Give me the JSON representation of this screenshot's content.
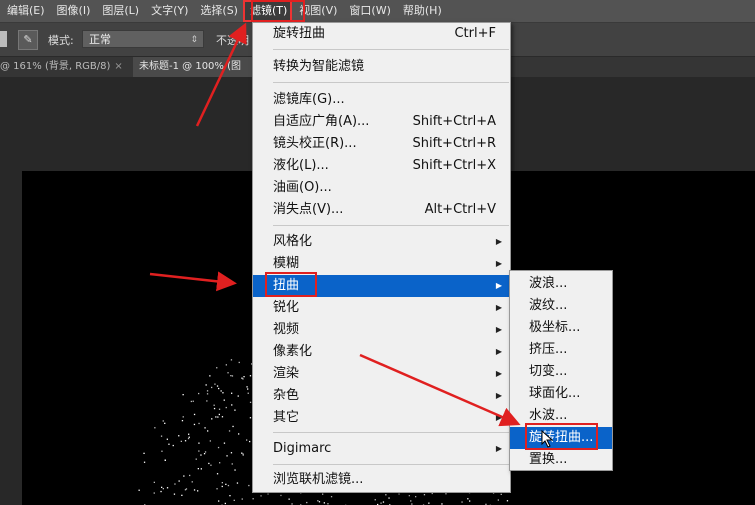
{
  "menubar": {
    "items": [
      {
        "label": "编辑(E)"
      },
      {
        "label": "图像(I)"
      },
      {
        "label": "图层(L)"
      },
      {
        "label": "文字(Y)"
      },
      {
        "label": "选择(S)"
      },
      {
        "label": "滤镜(T)"
      },
      {
        "label": "视图(V)"
      },
      {
        "label": "窗口(W)"
      },
      {
        "label": "帮助(H)"
      }
    ]
  },
  "options": {
    "mode_label": "模式:",
    "mode_value": "正常",
    "opacity_label": "不透明"
  },
  "tabs": [
    {
      "label": "@ 161% (背景, RGB/8)",
      "close": "×"
    },
    {
      "label": "未标题-1 @ 100% (图"
    }
  ],
  "filter_menu": {
    "items": [
      {
        "label": "旋转扭曲",
        "shortcut": "Ctrl+F"
      },
      {
        "label": "转换为智能滤镜",
        "shortcut": ""
      },
      {
        "label": "滤镜库(G)...",
        "shortcut": ""
      },
      {
        "label": "自适应广角(A)...",
        "shortcut": "Shift+Ctrl+A"
      },
      {
        "label": "镜头校正(R)...",
        "shortcut": "Shift+Ctrl+R"
      },
      {
        "label": "液化(L)...",
        "shortcut": "Shift+Ctrl+X"
      },
      {
        "label": "油画(O)...",
        "shortcut": ""
      },
      {
        "label": "消失点(V)...",
        "shortcut": "Alt+Ctrl+V"
      },
      {
        "label": "风格化",
        "shortcut": ""
      },
      {
        "label": "模糊",
        "shortcut": ""
      },
      {
        "label": "扭曲",
        "shortcut": ""
      },
      {
        "label": "锐化",
        "shortcut": ""
      },
      {
        "label": "视频",
        "shortcut": ""
      },
      {
        "label": "像素化",
        "shortcut": ""
      },
      {
        "label": "渲染",
        "shortcut": ""
      },
      {
        "label": "杂色",
        "shortcut": ""
      },
      {
        "label": "其它",
        "shortcut": ""
      },
      {
        "label": "Digimarc",
        "shortcut": ""
      },
      {
        "label": "浏览联机滤镜...",
        "shortcut": ""
      }
    ],
    "submenu_glyph": "▶"
  },
  "distort_submenu": {
    "items": [
      {
        "label": "波浪..."
      },
      {
        "label": "波纹..."
      },
      {
        "label": "极坐标..."
      },
      {
        "label": "挤压..."
      },
      {
        "label": "切变..."
      },
      {
        "label": "球面化..."
      },
      {
        "label": "水波..."
      },
      {
        "label": "旋转扭曲..."
      },
      {
        "label": "置换..."
      }
    ]
  },
  "colors": {
    "highlight": "#0a63c9",
    "annotation": "#e02020"
  },
  "icons": {
    "tool": "brush-preset-icon",
    "cursor": "mouse-pointer-icon"
  }
}
